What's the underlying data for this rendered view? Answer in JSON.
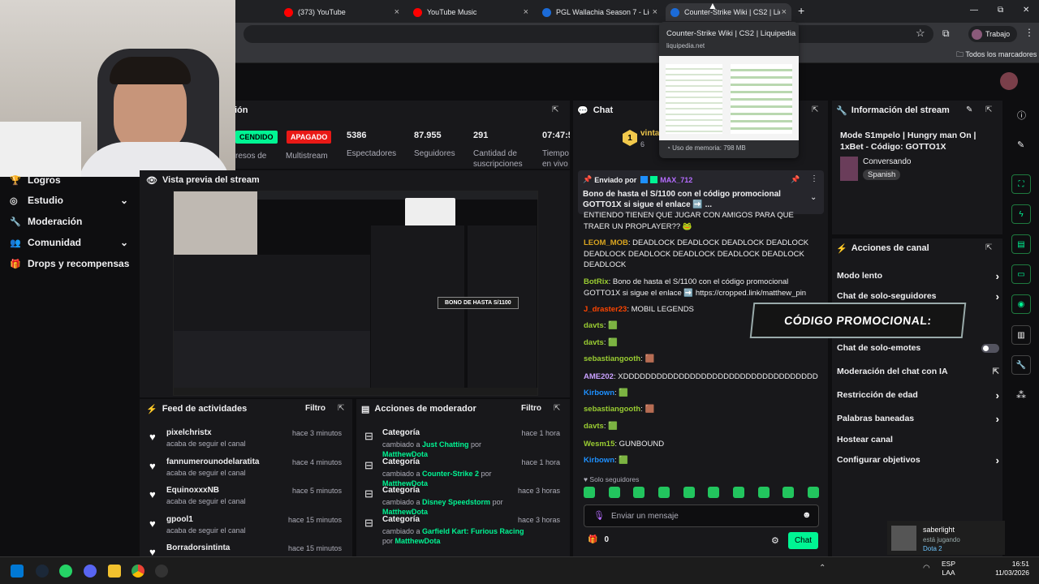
{
  "tabs": [
    {
      "title": "(373) YouTube",
      "fav": "#ff0000"
    },
    {
      "title": "YouTube Music",
      "fav": "#ff0000"
    },
    {
      "title": "PGL Wallachia Season 7 - Liquip",
      "fav": "#1b6bd8"
    },
    {
      "title": "Counter-Strike Wiki | CS2 | Liqu",
      "fav": "#1b6bd8"
    }
  ],
  "tab_close": "×",
  "new_tab": "+",
  "window": {
    "minimize": "—",
    "restore": "⧉",
    "close": "✕"
  },
  "profile": {
    "name": "Trabajo"
  },
  "bookmarks": {
    "all": "Todos los marcadores"
  },
  "tooltip": {
    "title": "Counter-Strike Wiki | CS2 | Liquipedia",
    "domain": "liquipedia.net",
    "memory": "Uso de memoria: 798 MB"
  },
  "stats": {
    "section_title": "ión",
    "badge_on": "CENDIDO",
    "badge_off": "APAGADO",
    "items": [
      {
        "value": "",
        "label": "resos de"
      },
      {
        "value": "",
        "label": "Multistream"
      },
      {
        "value": "5386",
        "label": "Espectadores"
      },
      {
        "value": "87.955",
        "label": "Seguidores"
      },
      {
        "value": "291",
        "label": "Cantidad de suscripciones"
      },
      {
        "value": "07:47:5",
        "label": "Tiempo en vivo"
      }
    ]
  },
  "sidebar": {
    "items": [
      {
        "label": "Logros",
        "icon": "trophy-icon",
        "chev": false
      },
      {
        "label": "Estudio",
        "icon": "studio-icon",
        "chev": true
      },
      {
        "label": "Moderación",
        "icon": "wrench-icon",
        "chev": false
      },
      {
        "label": "Comunidad",
        "icon": "community-icon",
        "chev": true
      },
      {
        "label": "Drops y recompensas",
        "icon": "gift-icon",
        "chev": false
      }
    ]
  },
  "preview": {
    "title": "Vista previa del stream",
    "promo": "BONO DE HASTA S/1100"
  },
  "feed": {
    "title": "Feed de actividades",
    "filter": "Filtro",
    "items": [
      {
        "name": "pixelchristx",
        "sub": "acaba de seguir el canal",
        "time": "hace 3 minutos"
      },
      {
        "name": "fannumerounodelaratita",
        "sub": "acaba de seguir el canal",
        "time": "hace 4 minutos"
      },
      {
        "name": "EquinoxxxNB",
        "sub": "acaba de seguir el canal",
        "time": "hace 5 minutos"
      },
      {
        "name": "gpool1",
        "sub": "acaba de seguir el canal",
        "time": "hace 15 minutos"
      },
      {
        "name": "Borradorsintinta",
        "sub": "",
        "time": "hace 15 minutos"
      }
    ]
  },
  "modactions": {
    "title": "Acciones de moderador",
    "filter": "Filtro",
    "items": [
      {
        "title": "Categoría",
        "pre": "cambiado a ",
        "game": "Just Chatting",
        "by": " por ",
        "user": "MatthewDota",
        "time": "hace 1 hora"
      },
      {
        "title": "Categoría",
        "pre": "cambiado a ",
        "game": "Counter-Strike 2",
        "by": " por ",
        "user": "MatthewDota",
        "time": "hace 1 hora"
      },
      {
        "title": "Categoría",
        "pre": "cambiado a ",
        "game": "Disney Speedstorm",
        "by": " por ",
        "user": "MatthewDota",
        "time": "hace 3 horas"
      },
      {
        "title": "Categoría",
        "pre": "cambiado a ",
        "game": "Garfield Kart: Furious Racing",
        "by": " por ",
        "user": "MatthewDota",
        "time": "hace 3 horas"
      }
    ]
  },
  "chat": {
    "title": "Chat",
    "top_user": "vinta",
    "top_rank": "1",
    "top_count": "6",
    "pinned": {
      "by_prefix": "Enviado por",
      "by": "MAX_712",
      "text": "Bono de hasta el S/1100 con el código promocional GOTTO1X si sigue el enlace ➡️ ..."
    },
    "messages": [
      {
        "user": "",
        "color": "#efeff1",
        "text": "ENTIENDO TIENEN QUE JUGAR CON AMIGOS PARA QUE TRAER UN PROPLAYER?? 🐸"
      },
      {
        "user": "LEOM_MOB",
        "color": "#daa520",
        "text": "DEADLOCK DEADLOCK DEADLOCK DEADLOCK DEADLOCK DEADLOCK DEADLOCK DEADLOCK DEADLOCK DEADLOCK"
      },
      {
        "user": "BotRix",
        "color": "#9acd32",
        "text": "Bono de hasta el S/1100 con el código promocional GOTTO1X si sigue el enlace ➡️ https://cropped.link/matthew_pin"
      },
      {
        "user": "J_draster23",
        "color": "#ff4500",
        "text": "MOBIL LEGENDS"
      },
      {
        "user": "davts",
        "color": "#9acd32",
        "text": "🟩"
      },
      {
        "user": "davts",
        "color": "#9acd32",
        "text": "🟩"
      },
      {
        "user": "sebastiangooth",
        "color": "#9acd32",
        "text": "🟫"
      },
      {
        "user": "AME202",
        "color": "#c9a0ff",
        "text": "XDDDDDDDDDDDDDDDDDDDDDDDDDDDDDDDDDDD"
      },
      {
        "user": "Kirbown",
        "color": "#1e90ff",
        "text": "🟩"
      },
      {
        "user": "sebastiangooth",
        "color": "#9acd32",
        "text": "🟫"
      },
      {
        "user": "davts",
        "color": "#9acd32",
        "text": "🟩"
      },
      {
        "user": "Wesm15",
        "color": "#9acd32",
        "text": "GUNBOUND"
      },
      {
        "user": "Kirbown",
        "color": "#1e90ff",
        "text": "🟩"
      }
    ],
    "followers_only": "Solo seguidores",
    "input_placeholder": "Enviar un mensaje",
    "points": "0",
    "send": "Chat"
  },
  "streaminfo": {
    "title": "Información del stream",
    "stream_title": "Mode S1mpelo | Hungry man On | 1xBet - Código: GOTTO1X",
    "category": "Conversando",
    "tag": "Spanish"
  },
  "actions": {
    "title": "Acciones de canal",
    "promo": "CÓDIGO PROMOCIONAL:",
    "items": [
      {
        "label": "Modo lento",
        "kind": "chev"
      },
      {
        "label": "Chat de solo-seguidores",
        "kind": "chev"
      },
      {
        "label": "Chat de solo-emotes",
        "kind": "toggle"
      },
      {
        "label": "Moderación del chat con IA",
        "kind": "ext"
      },
      {
        "label": "Restricción de edad",
        "kind": "chev"
      },
      {
        "label": "Palabras baneadas",
        "kind": "chev"
      },
      {
        "label": "Hostear canal",
        "kind": "none"
      },
      {
        "label": "Configurar objetivos",
        "kind": "chev"
      }
    ]
  },
  "friend": {
    "name": "saberlight",
    "status": "está jugando",
    "game": "Dota 2"
  },
  "taskbar": {
    "lang": "ESP",
    "region": "LAA",
    "time": "16:51",
    "date": "11/03/2026"
  }
}
